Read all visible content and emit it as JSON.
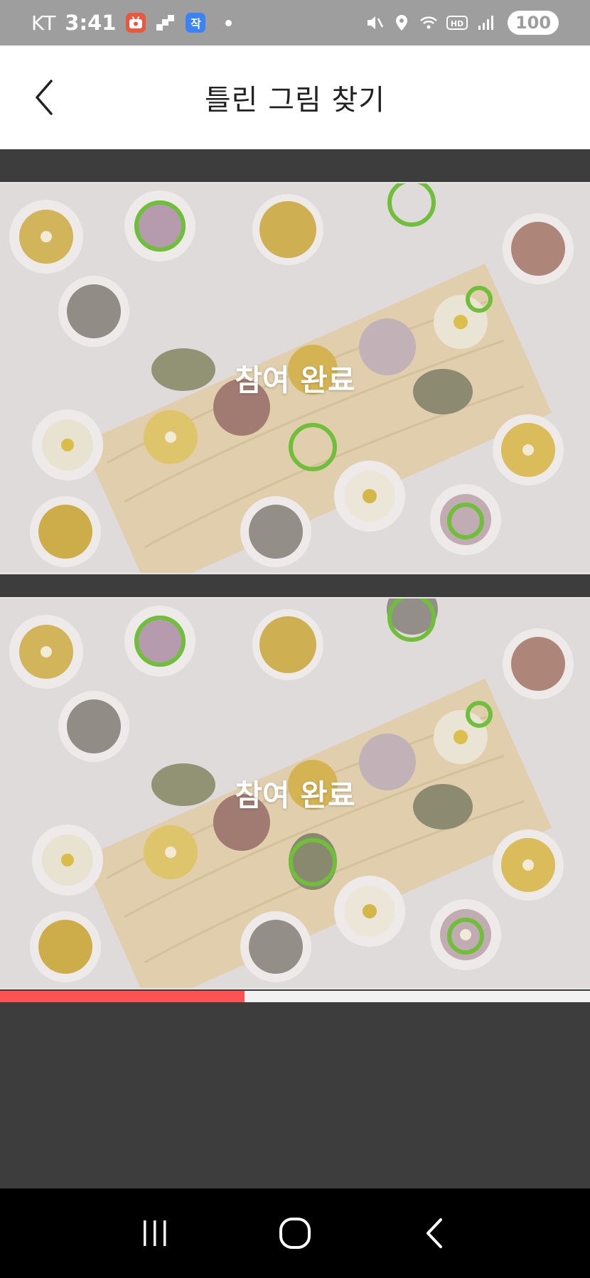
{
  "status_bar": {
    "carrier": "KT",
    "time": "3:41",
    "apps": [
      "youtube-like",
      "steps",
      "chat"
    ],
    "app_chat_glyph": "작",
    "battery": "100"
  },
  "app_bar": {
    "title": "틀린 그림 찾기",
    "back_icon": "chevron-left-icon"
  },
  "game": {
    "top_panel": {
      "overlay_text": "참여 완료"
    },
    "bottom_panel": {
      "overlay_text": "참여 완료"
    },
    "found_marker_color": "#6fbf3a",
    "progress_fraction": 0.415
  },
  "colors": {
    "progress": "#ff5353",
    "status_bar": "#9e9e9e",
    "background": "#3d3d3d"
  }
}
